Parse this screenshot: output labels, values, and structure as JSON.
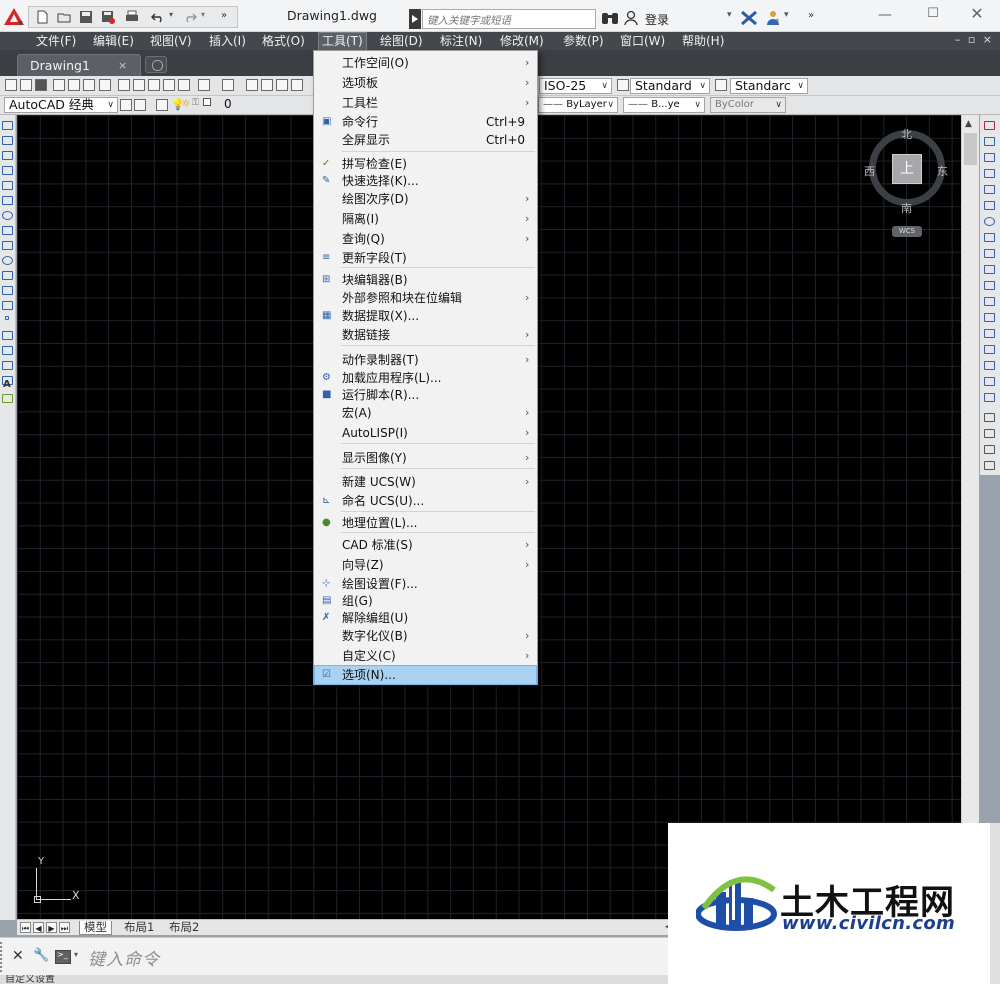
{
  "titlebar": {
    "doc_title": "Drawing1.dwg",
    "search_placeholder": "键入关键字或短语",
    "login": "登录"
  },
  "menubar": {
    "items": [
      "文件(F)",
      "编辑(E)",
      "视图(V)",
      "插入(I)",
      "格式(O)",
      "工具(T)",
      "绘图(D)",
      "标注(N)",
      "修改(M)",
      "参数(P)",
      "窗口(W)",
      "帮助(H)"
    ],
    "active": "工具(T)"
  },
  "tabs": {
    "doc_tab": "Drawing1",
    "close": "×"
  },
  "toolbars": {
    "workspace": "AutoCAD 经典",
    "layer": "0",
    "dimstyle": "ISO-25",
    "tablestyle": "Standard",
    "mleaderstyle": "Standarc",
    "linetype": "ByLayer",
    "lineweight": "B...ye",
    "plotstyle": "ByColor"
  },
  "viewcube": {
    "north": "北",
    "south": "南",
    "east": "东",
    "west": "西",
    "top": "上",
    "ucs": "WCS"
  },
  "ucs_icon": {
    "x": "X",
    "y": "Y"
  },
  "layout_tabs": [
    "模型",
    "布局1",
    "布局2"
  ],
  "command": {
    "placeholder": "键入命令"
  },
  "status": {
    "text": "自定义设置"
  },
  "tools_menu": {
    "items": [
      {
        "label": "工作空间(O)",
        "sub": true
      },
      {
        "label": "选项板",
        "sub": true
      },
      {
        "label": "工具栏",
        "sub": true
      },
      {
        "label": "命令行",
        "shortcut": "Ctrl+9",
        "icon": "command-line-icon"
      },
      {
        "label": "全屏显示",
        "shortcut": "Ctrl+0"
      },
      {
        "label": "拼写检查(E)",
        "icon": "spellcheck-icon"
      },
      {
        "label": "快速选择(K)...",
        "icon": "quick-select-icon"
      },
      {
        "label": "绘图次序(D)",
        "sub": true
      },
      {
        "label": "隔离(I)",
        "sub": true
      },
      {
        "label": "查询(Q)",
        "sub": true
      },
      {
        "label": "更新字段(T)",
        "icon": "update-field-icon"
      },
      {
        "label": "块编辑器(B)",
        "icon": "block-editor-icon"
      },
      {
        "label": "外部参照和块在位编辑",
        "sub": true
      },
      {
        "label": "数据提取(X)...",
        "icon": "data-extraction-icon"
      },
      {
        "label": "数据链接",
        "sub": true
      },
      {
        "label": "动作录制器(T)",
        "sub": true
      },
      {
        "label": "加载应用程序(L)...",
        "icon": "load-app-icon"
      },
      {
        "label": "运行脚本(R)...",
        "icon": "run-script-icon"
      },
      {
        "label": "宏(A)",
        "sub": true
      },
      {
        "label": "AutoLISP(I)",
        "sub": true
      },
      {
        "label": "显示图像(Y)",
        "sub": true
      },
      {
        "label": "新建 UCS(W)",
        "sub": true
      },
      {
        "label": "命名 UCS(U)...",
        "icon": "named-ucs-icon"
      },
      {
        "label": "地理位置(L)...",
        "icon": "globe-icon"
      },
      {
        "label": "CAD 标准(S)",
        "sub": true
      },
      {
        "label": "向导(Z)",
        "sub": true
      },
      {
        "label": "绘图设置(F)...",
        "icon": "drafting-settings-icon"
      },
      {
        "label": "组(G)",
        "icon": "group-icon"
      },
      {
        "label": "解除编组(U)",
        "icon": "ungroup-icon"
      },
      {
        "label": "数字化仪(B)",
        "sub": true
      },
      {
        "label": "自定义(C)",
        "sub": true
      },
      {
        "label": "选项(N)...",
        "icon": "options-icon",
        "highlighted": true
      }
    ],
    "submenu_glyph": "›"
  },
  "watermark": {
    "name": "土木工程网",
    "url": "www.civilcn.com"
  },
  "colors": {
    "menubar": "#44474c",
    "canvas": "#000000",
    "highlight": "#a8d1f2",
    "autocad_red": "#d42727"
  }
}
